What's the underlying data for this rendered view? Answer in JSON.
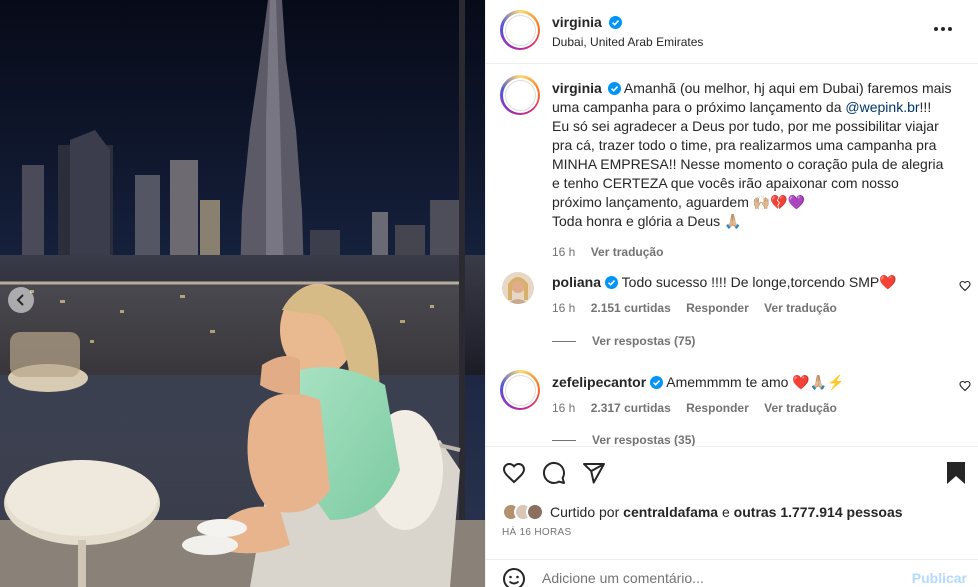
{
  "post": {
    "author": "virginia",
    "location": "Dubai, United Arab Emirates",
    "image_alt": "Woman in mint green lace pajamas sitting on a balcony with Burj Khalifa at night"
  },
  "caption": {
    "username": "virginia",
    "text_before_mention": "Amanhã (ou melhor, hj aqui em Dubai) faremos mais uma campanha para o próximo lançamento da",
    "mention": "@wepink.br",
    "text_after_mention": "!!! Eu só sei agradecer a Deus por tudo, por me possibilitar viajar pra cá, trazer todo o time, pra realizarmos uma campanha pra MINHA EMPRESA!! Nesse momento o coração pula de alegria e tenho CERTEZA que vocês irão apaixonar com nosso próximo lançamento, aguardem 🙌🏼💔💜",
    "line2": "Toda honra e glória a Deus 🙏🏼",
    "time": "16 h",
    "translate": "Ver tradução"
  },
  "comments": [
    {
      "username": "poliana",
      "text": "Todo sucesso !!!! De longe,torcendo SMP❤️",
      "time": "16 h",
      "likes": "2.151 curtidas",
      "reply": "Responder",
      "translate": "Ver tradução",
      "replies": "Ver respostas (75)"
    },
    {
      "username": "zefelipecantor",
      "text": "Amemmmm te amo ❤️🙏🏼⚡",
      "time": "16 h",
      "likes": "2.317 curtidas",
      "reply": "Responder",
      "translate": "Ver tradução",
      "replies": "Ver respostas (35)"
    }
  ],
  "likes": {
    "prefix": "Curtido por",
    "first_liker": "centraldafama",
    "middle": "e",
    "others": "outras 1.777.914 pessoas"
  },
  "posted_ago": "HÁ 16 HORAS",
  "comment_box": {
    "placeholder": "Adicione um comentário...",
    "publish_label": "Publicar"
  },
  "icons": {
    "more": "more-horizontal-icon",
    "like": "heart-icon",
    "comment": "comment-icon",
    "share": "send-icon",
    "save": "bookmark-icon",
    "emoji": "emoji-icon",
    "verified": "verified-badge-icon"
  },
  "colors": {
    "verified": "#0095f6",
    "mention": "#00376b",
    "muted": "#737373",
    "publish_disabled": "#b3dbff"
  }
}
